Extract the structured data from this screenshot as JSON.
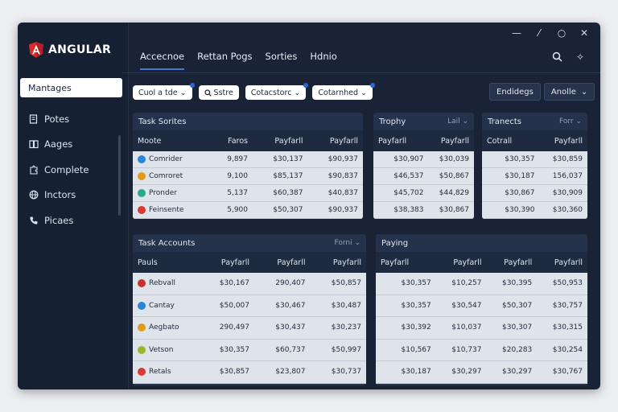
{
  "sidebar": {
    "brand": "ANGULAR",
    "primary": "Mantages",
    "items": [
      {
        "label": "Potes",
        "icon": "doc-icon"
      },
      {
        "label": "Aages",
        "icon": "book-icon"
      },
      {
        "label": "Complete",
        "icon": "puzzle-icon"
      },
      {
        "label": "Inctors",
        "icon": "globe-icon"
      },
      {
        "label": "Picaes",
        "icon": "phone-icon"
      }
    ]
  },
  "topnav": {
    "tabs": [
      "Accecnoe",
      "Rettan Pogs",
      "Sorties",
      "Hdnio"
    ]
  },
  "filters": [
    "Cuol a tde",
    "Sstre",
    "Cotacstorc",
    "Cotarnhed"
  ],
  "actions": {
    "primary": "Endidegs",
    "secondary": "Anolle"
  },
  "panels": {
    "task_series": {
      "title": "Task Sorites",
      "headers": [
        "Moote",
        "Faros",
        "Payfarll",
        "Payfarll"
      ],
      "rows": [
        {
          "cells": [
            "Comrider",
            "9,897",
            "$30,137",
            "$90,937"
          ],
          "color": "#2d83d6"
        },
        {
          "cells": [
            "Comroret",
            "9,100",
            "$85,137",
            "$90,837"
          ],
          "color": "#e09b1b"
        },
        {
          "cells": [
            "Pronder",
            "5,137",
            "$60,387",
            "$40,837"
          ],
          "color": "#2aa88f"
        },
        {
          "cells": [
            "Feinsente",
            "5,900",
            "$50,307",
            "$90,937"
          ],
          "color": "#d63a32"
        }
      ]
    },
    "trophy": {
      "title": "Trophy",
      "filter": "Lail",
      "headers": [
        "Payfarll",
        "Payfarll"
      ],
      "rows": [
        [
          "$30,907",
          "$30,039"
        ],
        [
          "$46,537",
          "$50,867"
        ],
        [
          "$45,702",
          "$44,829"
        ],
        [
          "$38,383",
          "$30,867"
        ]
      ]
    },
    "transacts": {
      "title": "Tranects",
      "filter": "Forr",
      "headers": [
        "Cotrall",
        "Payfarll"
      ],
      "rows": [
        [
          "$30,357",
          "$30,859"
        ],
        [
          "$30,187",
          "156,037"
        ],
        [
          "$30,867",
          "$30,909"
        ],
        [
          "$30,390",
          "$30,360"
        ]
      ]
    },
    "task_accounts": {
      "title": "Task Accounts",
      "filter": "Forni",
      "headers": [
        "Pauls",
        "Payfarll",
        "Payfarll",
        "Payfarll"
      ],
      "rows": [
        {
          "cells": [
            "Rebvall",
            "$30,167",
            "290,407",
            "$50,857"
          ],
          "color": "#c8322c"
        },
        {
          "cells": [
            "Cantay",
            "$50,007",
            "$30,467",
            "$30,487"
          ],
          "color": "#2d83d6"
        },
        {
          "cells": [
            "Aegbato",
            "290,497",
            "$30,437",
            "$30,237"
          ],
          "color": "#e09b1b"
        },
        {
          "cells": [
            "Vetson",
            "$30,357",
            "$60,737",
            "$50,997"
          ],
          "color": "#9bb52a"
        },
        {
          "cells": [
            "Retals",
            "$30,857",
            "$23,807",
            "$30,737"
          ],
          "color": "#d63a32"
        }
      ]
    },
    "paying": {
      "title": "Paying",
      "headers": [
        "Payfarll",
        "Payfarll",
        "Payfarll",
        "Payfarll"
      ],
      "rows": [
        [
          "$30,357",
          "$10,257",
          "$30,395",
          "$50,953"
        ],
        [
          "$30,357",
          "$30,547",
          "$50,307",
          "$30,757"
        ],
        [
          "$30,392",
          "$10,037",
          "$30,307",
          "$30,315"
        ],
        [
          "$10,567",
          "$10,737",
          "$20,283",
          "$30,254"
        ],
        [
          "$30,187",
          "$30,297",
          "$30,297",
          "$30,767"
        ]
      ]
    }
  },
  "colors": {
    "accent": "#2b67d6",
    "window_bg": "#1a2336",
    "table_bg": "#dfe3ea"
  }
}
